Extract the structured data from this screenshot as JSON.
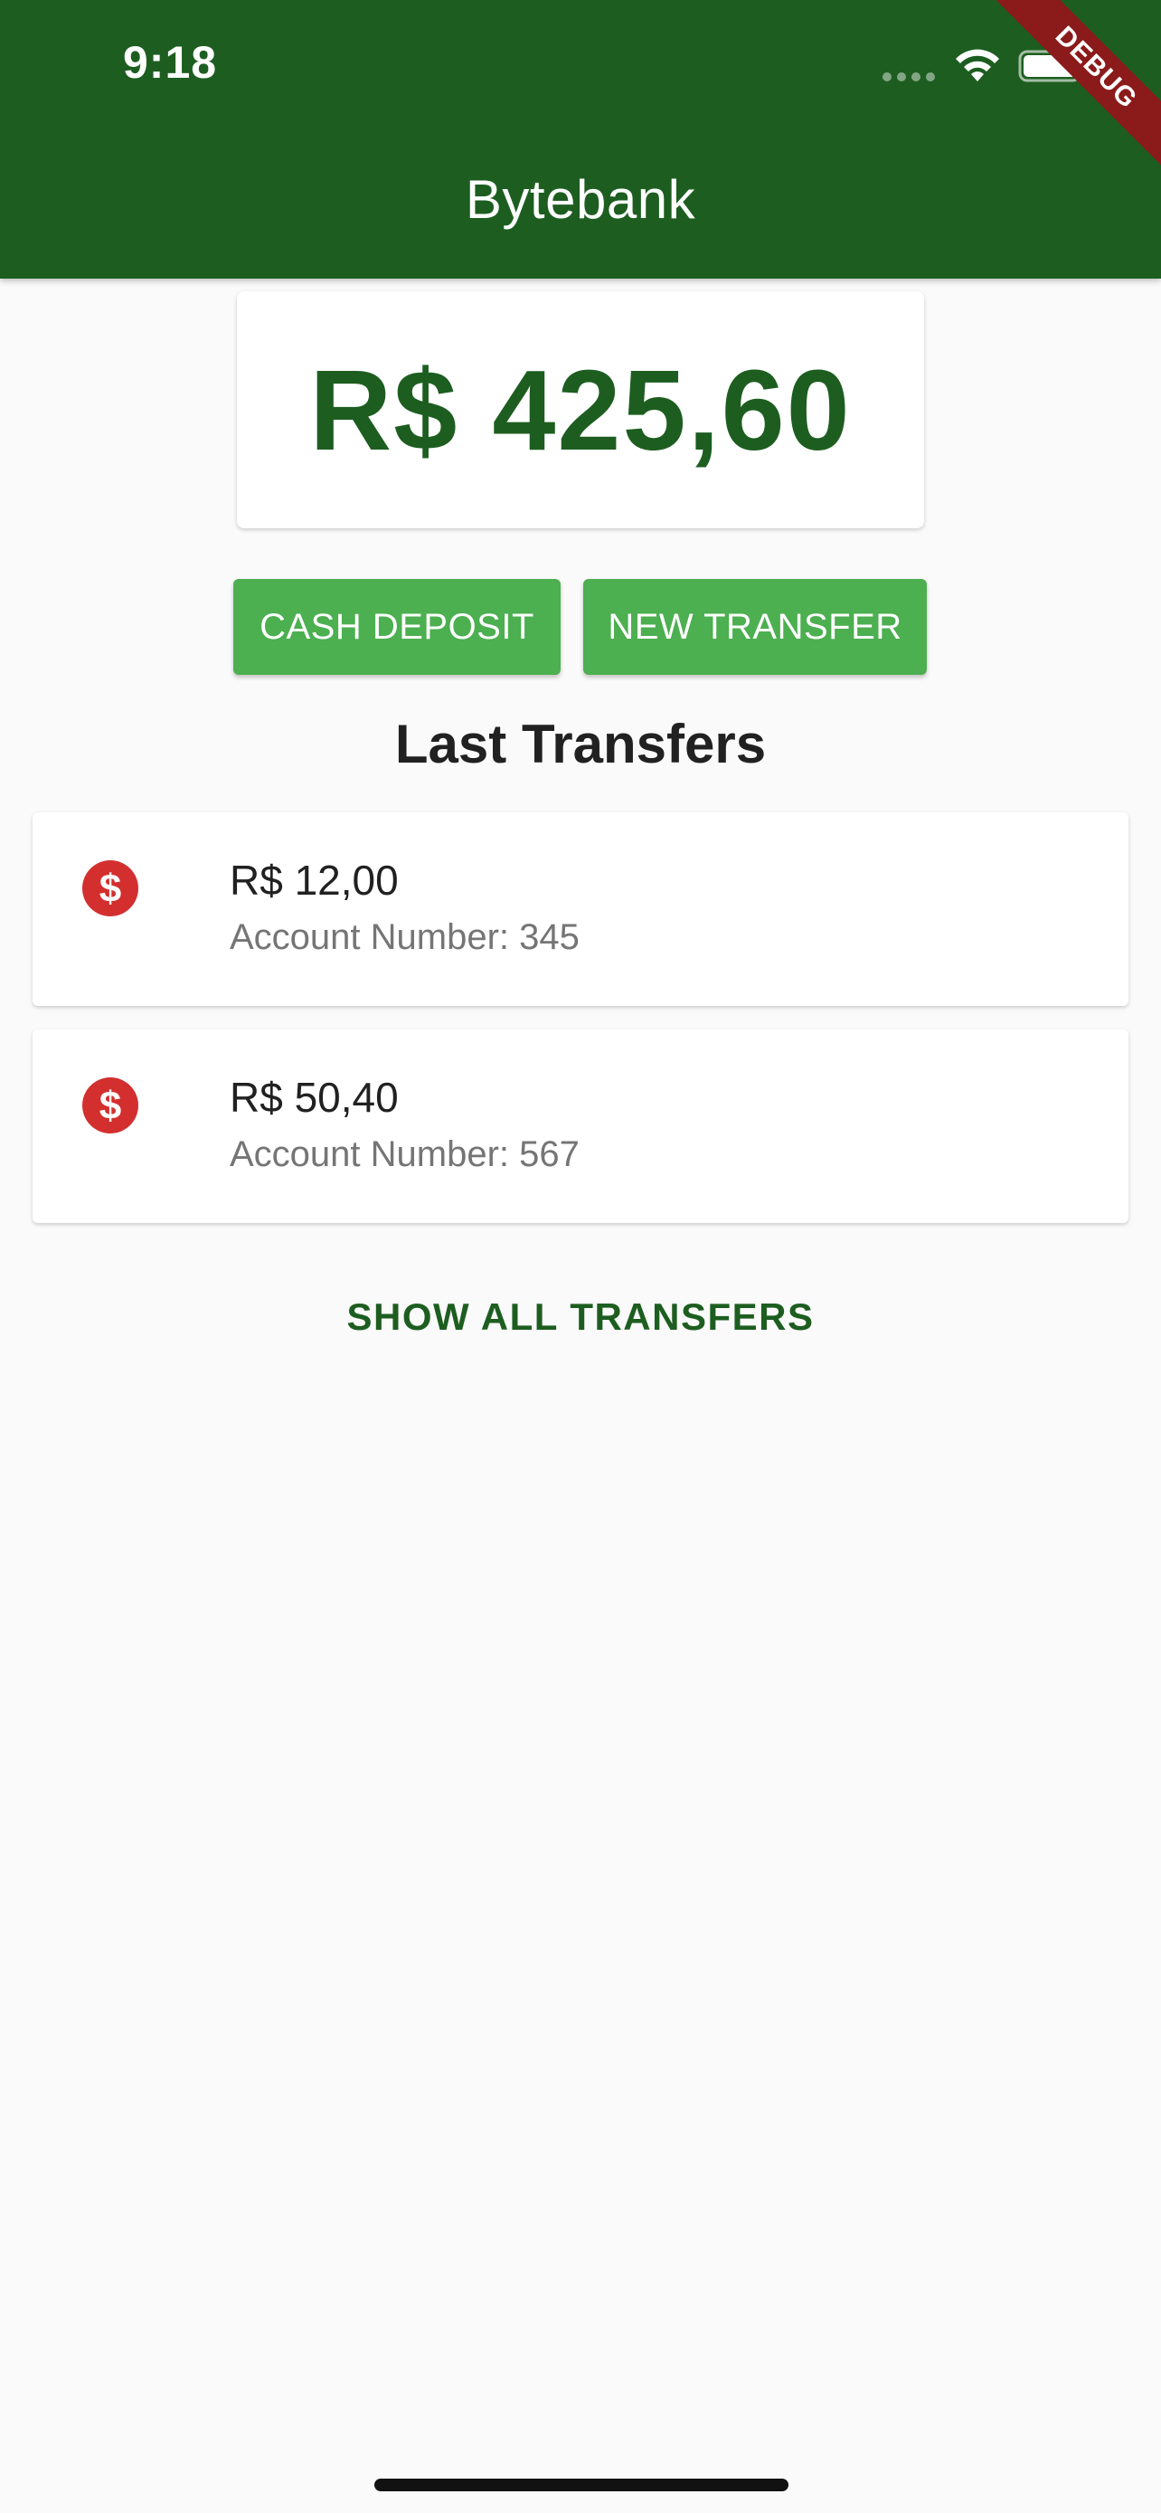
{
  "status_bar": {
    "time": "9:18",
    "wifi_icon": "wifi-icon",
    "battery_icon": "battery-icon"
  },
  "debug_banner": "DEBUG",
  "app_bar": {
    "title": "Bytebank"
  },
  "balance": {
    "value": "R$ 425,60"
  },
  "actions": {
    "cash_deposit_label": "CASH DEPOSIT",
    "new_transfer_label": "NEW TRANSFER"
  },
  "last_transfers": {
    "heading": "Last Transfers",
    "items": [
      {
        "value": "R$ 12,00",
        "account": "Account Number: 345",
        "icon": "dollar-icon"
      },
      {
        "value": "R$ 50,40",
        "account": "Account Number: 567",
        "icon": "dollar-icon"
      }
    ],
    "show_all_label": "SHOW ALL TRANSFERS"
  },
  "colors": {
    "app_bar": "#1d5e20",
    "primary_text": "#1d5e20",
    "button": "#4caf50",
    "icon_red": "#d32f2f",
    "debug_banner": "#8b1a1a"
  }
}
